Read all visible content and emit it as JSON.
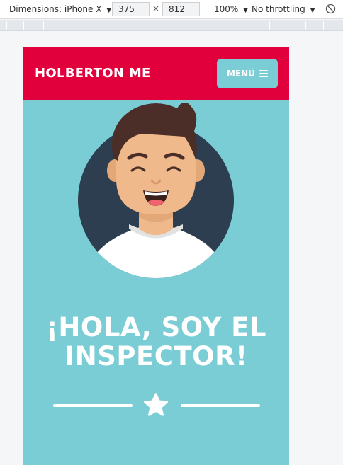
{
  "devtools": {
    "dimensions_label": "Dimensions: iPhone X",
    "width_value": "375",
    "height_value": "812",
    "times_symbol": "×",
    "zoom_label": "100%",
    "throttling_label": "No throttling",
    "caret": "▼"
  },
  "site": {
    "logo": "HOLBERTON ME",
    "menu_label": "MENÚ",
    "hero_heading": "¡HOLA, SOY EL INSPECTOR!"
  },
  "colors": {
    "header": "#e1003c",
    "background": "#7acdd4",
    "avatar_circle": "#2d3e50",
    "hair": "#4b2e28",
    "skin": "#f0b98c",
    "shirt": "#ffffff"
  },
  "icons": {
    "menu": "hamburger-icon",
    "divider": "star-icon",
    "rotate": "rotate-icon"
  }
}
